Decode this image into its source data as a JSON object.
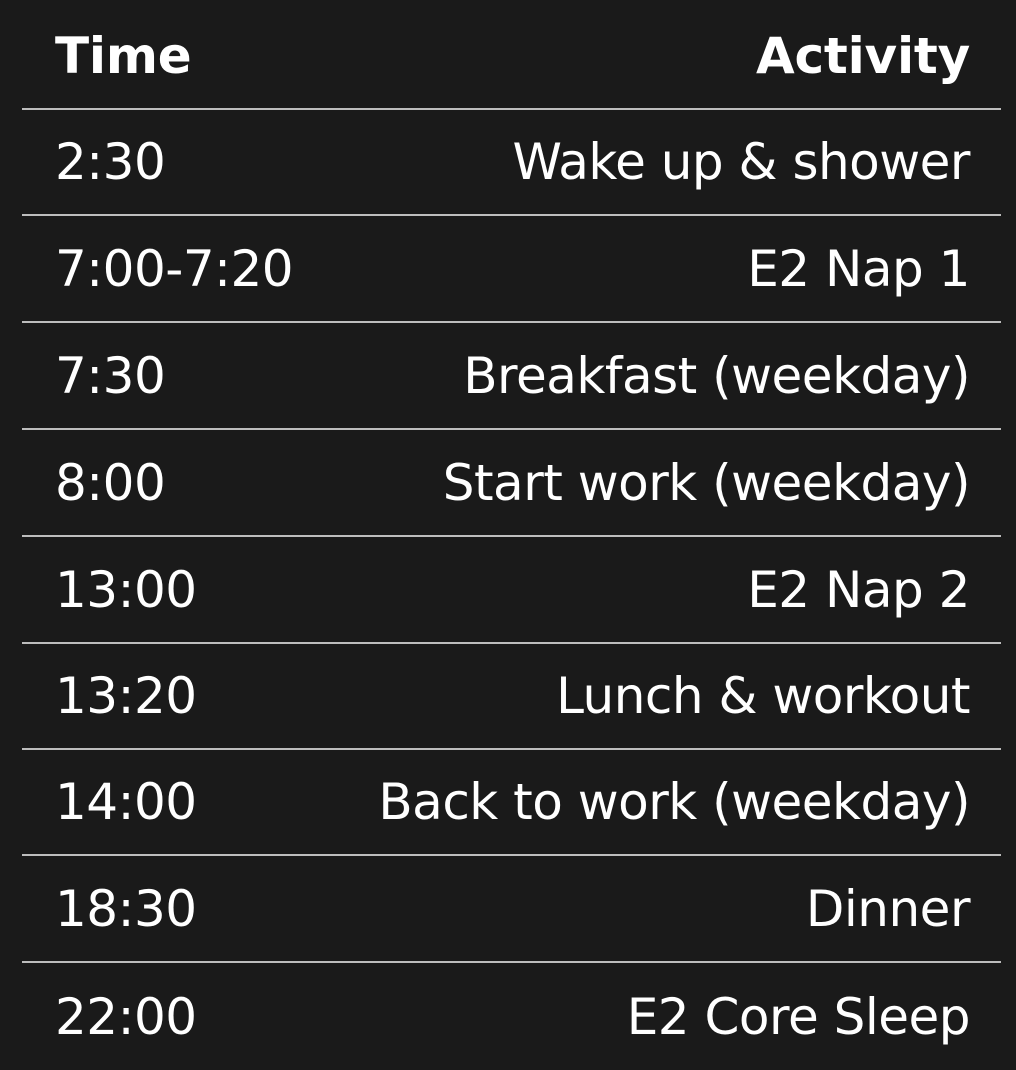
{
  "table": {
    "columns": {
      "time": "Time",
      "activity": "Activity"
    },
    "rows": [
      {
        "time": "2:30",
        "activity": "Wake up & shower"
      },
      {
        "time": "7:00-7:20",
        "activity": "E2 Nap 1"
      },
      {
        "time": "7:30",
        "activity": "Breakfast (weekday)"
      },
      {
        "time": "8:00",
        "activity": "Start work (weekday)"
      },
      {
        "time": "13:00",
        "activity": "E2 Nap 2"
      },
      {
        "time": "13:20",
        "activity": "Lunch & workout"
      },
      {
        "time": "14:00",
        "activity": "Back to work (weekday)"
      },
      {
        "time": "18:30",
        "activity": "Dinner"
      },
      {
        "time": "22:00",
        "activity": "E2 Core Sleep"
      }
    ]
  },
  "colors": {
    "background": "#1a1a1a",
    "text": "#ffffff",
    "divider": "#bdbdbd"
  }
}
